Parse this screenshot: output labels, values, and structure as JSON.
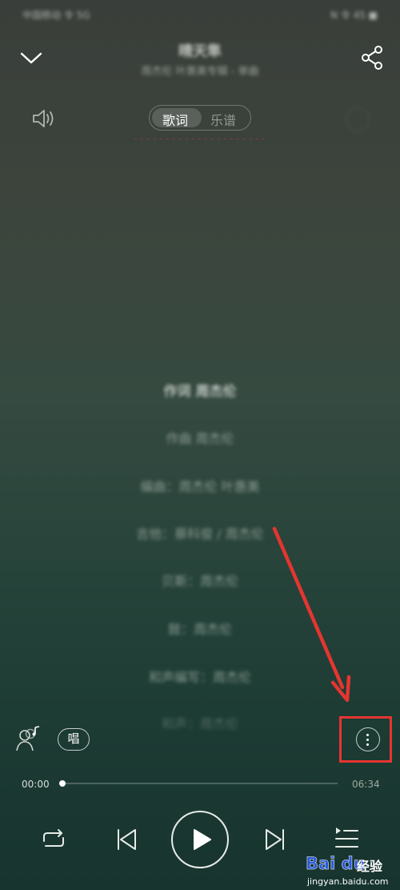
{
  "status_bar": {
    "left_text": "中国移动 令 5G",
    "right_text": "N 令 45 ■"
  },
  "header": {
    "title": "晴天隼",
    "subtitle": "周杰伦 叶惠美专辑 - 单曲"
  },
  "tabs": {
    "lyrics": "歌词",
    "score": "乐谱"
  },
  "lyrics": [
    "作词 周杰伦",
    "作曲 周杰伦",
    "编曲：周杰伦 叶惠美",
    "吉他：蔡科俊 / 周杰伦",
    "贝斯：周杰伦",
    "鼓：周杰伦",
    "和声编写：周杰伦",
    "和声：周杰伦"
  ],
  "controls": {
    "sing_label": "唱",
    "time_current": "00:00",
    "time_total": "06:34",
    "progress": 0.0
  },
  "watermark": {
    "logo": "Bai du",
    "text": "经验",
    "url": "jingyan.baidu.com"
  },
  "colors": {
    "highlight_red": "#e53530"
  },
  "icons": [
    "chevron-down-icon",
    "share-icon",
    "speaker-icon",
    "singer-icon",
    "more-vertical-icon",
    "repeat-icon",
    "previous-icon",
    "play-icon",
    "next-icon",
    "playlist-icon"
  ]
}
